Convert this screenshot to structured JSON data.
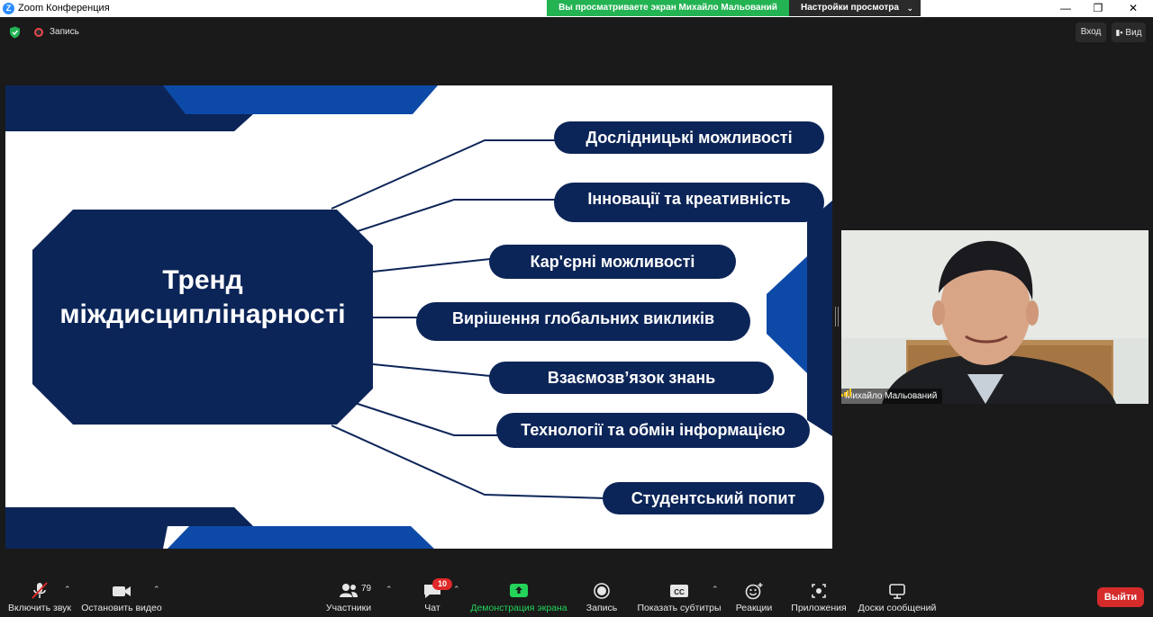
{
  "window": {
    "title": "Zoom Конференция",
    "share_banner": "Вы просматриваете экран Михайло Мальований",
    "view_settings": "Настройки просмотра",
    "controls": [
      "—",
      "❐",
      "✕"
    ]
  },
  "meeting_bar": {
    "recording_label": "Запись",
    "enter_button": "Вход",
    "view_button": "Вид"
  },
  "slide": {
    "center_title_line1": "Тренд",
    "center_title_line2": "міждисциплінарності",
    "branches": [
      "Дослідницькі можливості",
      "Інновації та креативність",
      "Кар'єрні можливості",
      "Вирішення глобальних викликів",
      "Взаємозв’язок знань",
      "Технології та обмін інформацією",
      "Студентський попит"
    ],
    "colors": {
      "dark": "#0c2558",
      "accent": "#0d4aa8",
      "background": "#ffffff"
    }
  },
  "video": {
    "participant_name": "Михайло Мальований"
  },
  "toolbar": {
    "unmute": "Включить звук",
    "stop_video": "Остановить видео",
    "participants": "Участники",
    "participants_count": "79",
    "chat": "Чат",
    "chat_badge": "10",
    "share_screen": "Демонстрация экрана",
    "record": "Запись",
    "captions": "Показать субтитры",
    "reactions": "Реакции",
    "apps": "Приложения",
    "whiteboards": "Доски сообщений",
    "leave": "Выйти",
    "share_color": "#23d35a",
    "leave_color": "#d52b2b"
  }
}
